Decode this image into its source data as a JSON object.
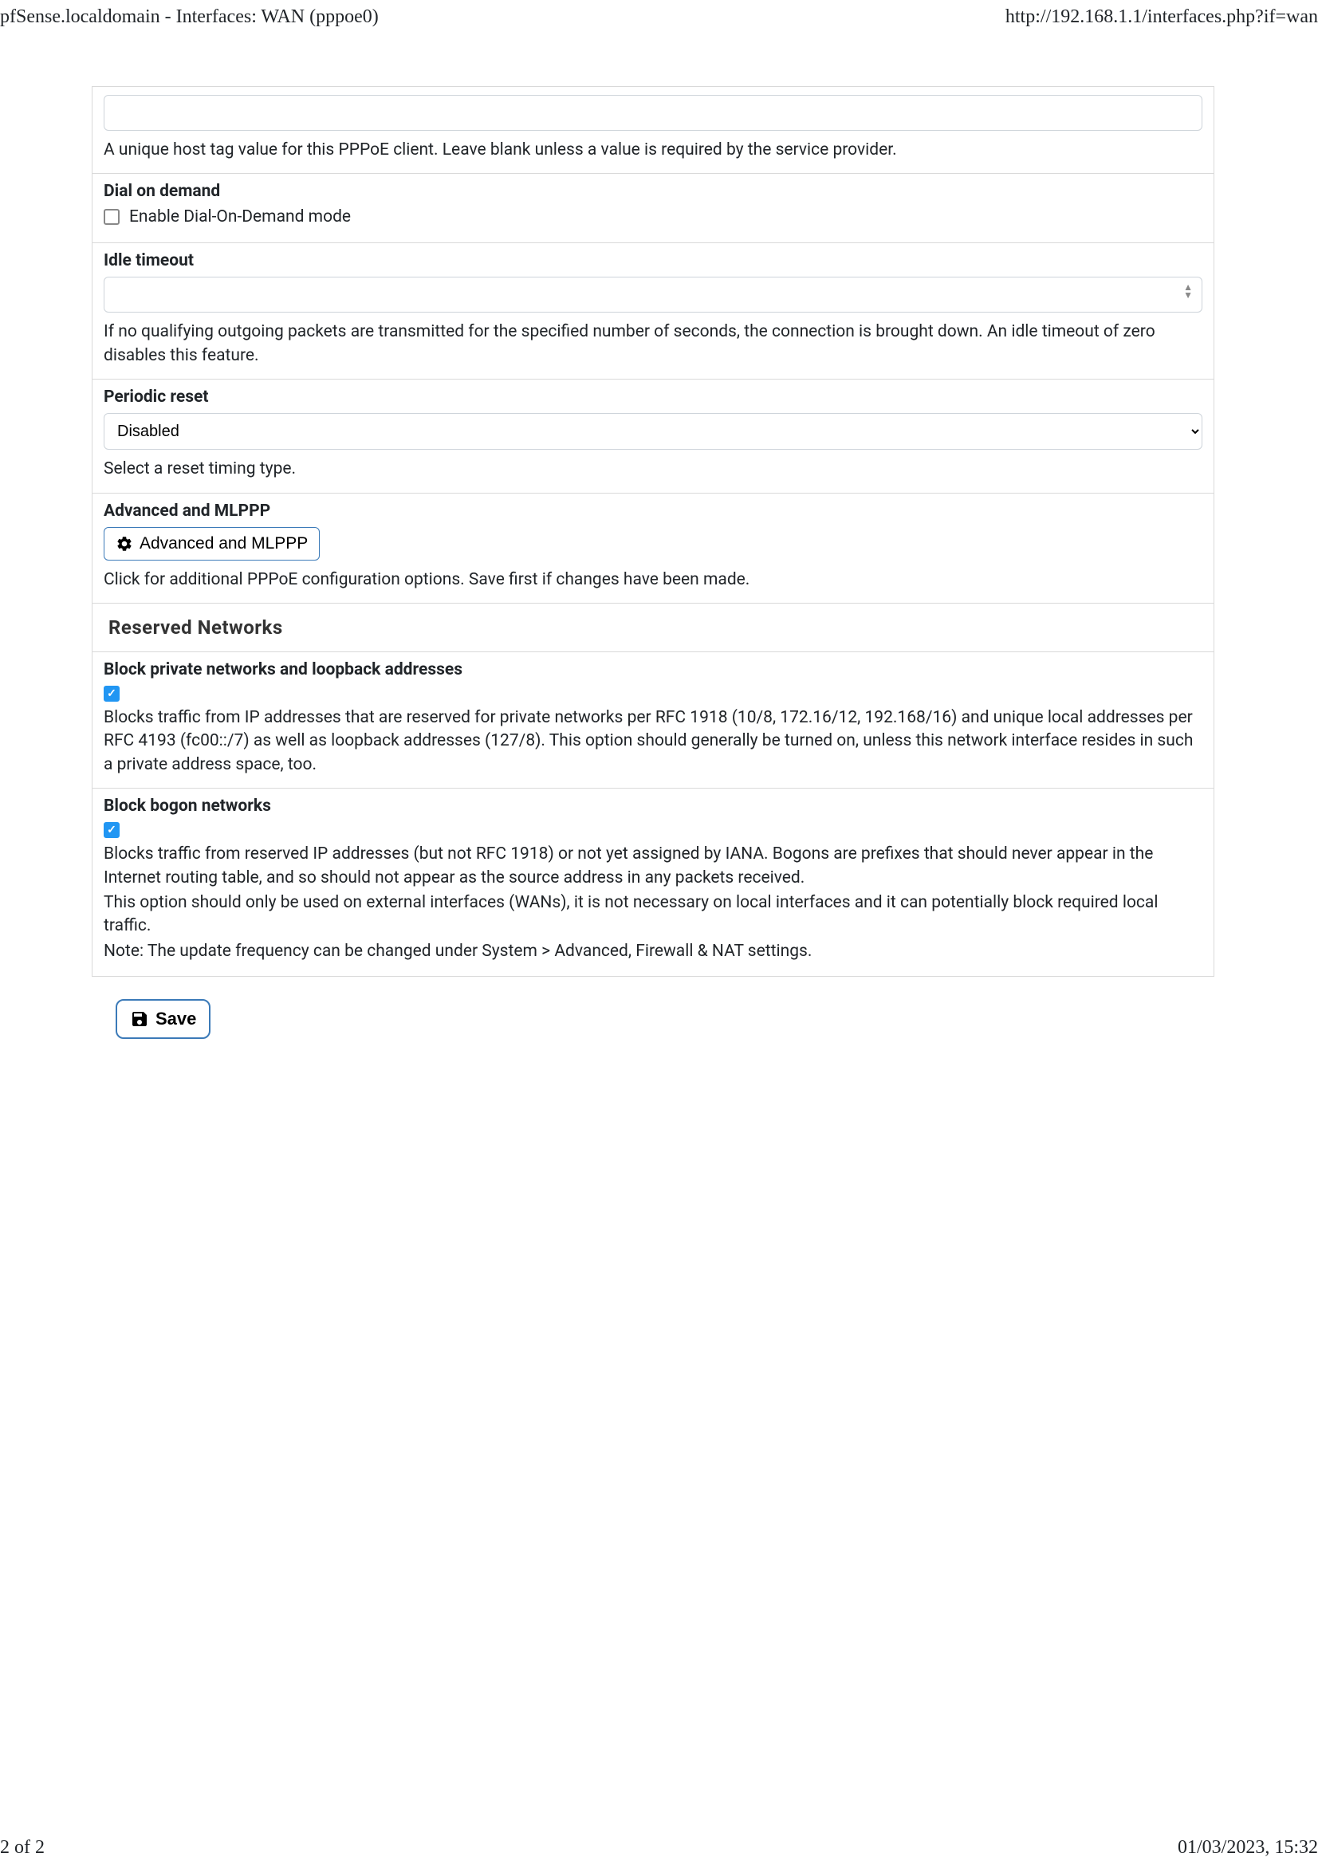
{
  "header": {
    "title": "pfSense.localdomain - Interfaces: WAN (pppoe0)",
    "url": "http://192.168.1.1/interfaces.php?if=wan"
  },
  "hosttag": {
    "value": "",
    "help": "A unique host tag value for this PPPoE client. Leave blank unless a value is required by the service provider."
  },
  "dial_on_demand": {
    "label": "Dial on demand",
    "checkbox_label": "Enable Dial-On-Demand mode",
    "checked": false
  },
  "idle_timeout": {
    "label": "Idle timeout",
    "value": "",
    "help": "If no qualifying outgoing packets are transmitted for the specified number of seconds, the connection is brought down. An idle timeout of zero disables this feature."
  },
  "periodic_reset": {
    "label": "Periodic reset",
    "selected": "Disabled",
    "help": "Select a reset timing type."
  },
  "advanced_mlppp": {
    "label": "Advanced and MLPPP",
    "button_label": "Advanced and MLPPP",
    "help": "Click for additional PPPoE configuration options. Save first if changes have been made."
  },
  "reserved_networks": {
    "heading": "Reserved Networks",
    "block_private": {
      "label": "Block private networks and loopback addresses",
      "checked": true,
      "help": "Blocks traffic from IP addresses that are reserved for private networks per RFC 1918 (10/8, 172.16/12, 192.168/16) and unique local addresses per RFC 4193 (fc00::/7) as well as loopback addresses (127/8). This option should generally be turned on, unless this network interface resides in such a private address space, too."
    },
    "block_bogon": {
      "label": "Block bogon networks",
      "checked": true,
      "help1": "Blocks traffic from reserved IP addresses (but not RFC 1918) or not yet assigned by IANA. Bogons are prefixes that should never appear in the Internet routing table, and so should not appear as the source address in any packets received.",
      "help2": "This option should only be used on external interfaces (WANs), it is not necessary on local interfaces and it can potentially block required local traffic.",
      "help3": "Note: The update frequency can be changed under System > Advanced, Firewall & NAT settings."
    }
  },
  "save_button": "Save",
  "footer": {
    "page": "2 of 2",
    "datetime": "01/03/2023, 15:32"
  }
}
